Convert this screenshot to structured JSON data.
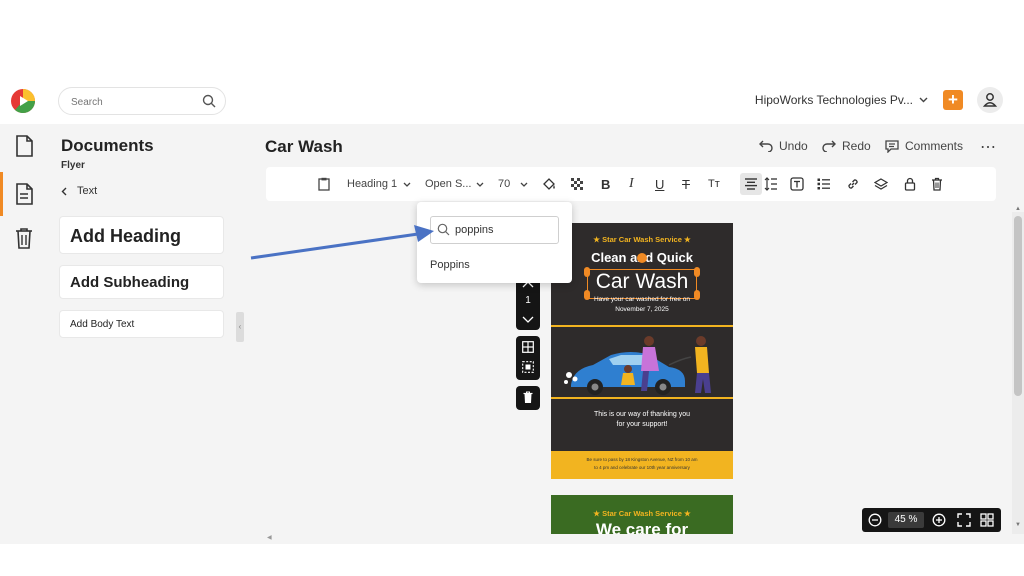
{
  "app": {
    "accent": "#f08a24"
  },
  "search": {
    "placeholder": "Search"
  },
  "header": {
    "company": "HipoWorks Technologies Pv..."
  },
  "panel": {
    "title": "Documents",
    "subtitle": "Flyer",
    "back_label": "Text",
    "cards": {
      "heading": "Add Heading",
      "subheading": "Add Subheading",
      "body": "Add Body Text"
    }
  },
  "document": {
    "title": "Car Wash",
    "actions": {
      "undo": "Undo",
      "redo": "Redo",
      "comments": "Comments"
    }
  },
  "toolbar": {
    "text_style": "Heading 1",
    "font_family": "Open S...",
    "font_size": "70"
  },
  "font_dropdown": {
    "query": "poppins",
    "option": "Poppins"
  },
  "flyer": {
    "service": "★  Star Car Wash Service  ★",
    "headline1": "Clean and Quick",
    "headline2": "Car Wash",
    "offer": "Have your car washed for free on",
    "date": "November 7, 2025",
    "thanks1": "This is our way of thanking you",
    "thanks2": "for your support!",
    "footer1": "Be sure to pass by 18 Kingston Avenue, NZ from 10 am",
    "footer2": "to 4 pm and celebrate our 10th year anniversary",
    "page2_service": "★  Star Car Wash Service  ★",
    "page2_headline": "We care for"
  },
  "float_controls": {
    "page_number": "1"
  },
  "zoom": {
    "value": "45 %"
  }
}
